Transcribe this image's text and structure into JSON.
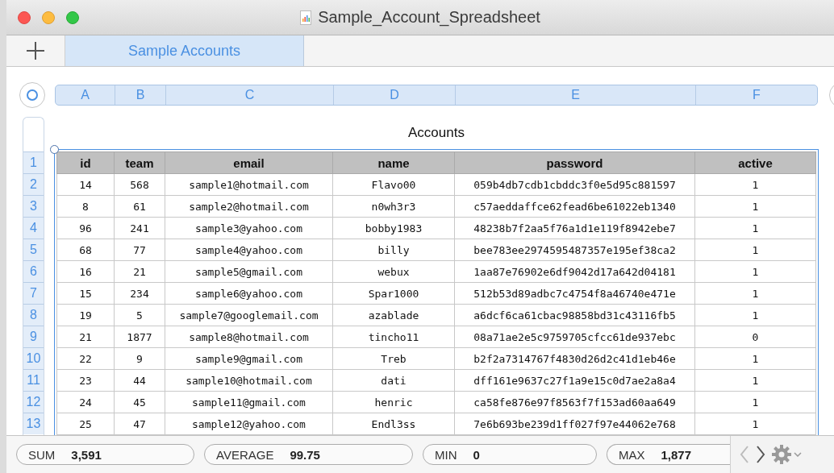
{
  "window": {
    "title": "Sample_Account_Spreadsheet"
  },
  "sheet_tabs": [
    {
      "label": "Sample Accounts",
      "selected": true
    }
  ],
  "column_letters": [
    "A",
    "B",
    "C",
    "D",
    "E",
    "F"
  ],
  "table": {
    "title": "Accounts",
    "row_numbers": [
      "1",
      "2",
      "3",
      "4",
      "5",
      "6",
      "7",
      "8",
      "9",
      "10",
      "11",
      "12",
      "13"
    ],
    "columns": [
      "id",
      "team",
      "email",
      "name",
      "password",
      "active"
    ],
    "rows": [
      [
        "14",
        "568",
        "sample1@hotmail.com",
        "Flavo00",
        "059b4db7cdb1cbddc3f0e5d95c881597",
        "1"
      ],
      [
        "8",
        "61",
        "sample2@hotmail.com",
        "n0wh3r3",
        "c57aeddaffce62fead6be61022eb1340",
        "1"
      ],
      [
        "96",
        "241",
        "sample3@yahoo.com",
        "bobby1983",
        "48238b7f2aa5f76a1d1e119f8942ebe7",
        "1"
      ],
      [
        "68",
        "77",
        "sample4@yahoo.com",
        "billy",
        "bee783ee2974595487357e195ef38ca2",
        "1"
      ],
      [
        "16",
        "21",
        "sample5@gmail.com",
        "webux",
        "1aa87e76902e6df9042d17a642d04181",
        "1"
      ],
      [
        "15",
        "234",
        "sample6@yahoo.com",
        "Spar1000",
        "512b53d89adbc7c4754f8a46740e471e",
        "1"
      ],
      [
        "19",
        "5",
        "sample7@googlemail.com",
        "azablade",
        "a6dcf6ca61cbac98858bd31c43116fb5",
        "1"
      ],
      [
        "21",
        "1877",
        "sample8@hotmail.com",
        "tincho11",
        "08a71ae2e5c9759705cfcc61de937ebc",
        "0"
      ],
      [
        "22",
        "9",
        "sample9@gmail.com",
        "Treb",
        "b2f2a7314767f4830d26d2c41d1eb46e",
        "1"
      ],
      [
        "23",
        "44",
        "sample10@hotmail.com",
        "dati",
        "dff161e9637c27f1a9e15c0d7ae2a8a4",
        "1"
      ],
      [
        "24",
        "45",
        "sample11@gmail.com",
        "henric",
        "ca58fe876e97f8563f7f153ad60aa649",
        "1"
      ],
      [
        "25",
        "47",
        "sample12@yahoo.com",
        "Endl3ss",
        "7e6b693be239d1ff027f97e44062e768",
        "1"
      ]
    ]
  },
  "status_bar": {
    "stats": [
      {
        "label": "SUM",
        "value": "3,591"
      },
      {
        "label": "AVERAGE",
        "value": "99.75"
      },
      {
        "label": "MIN",
        "value": "0"
      },
      {
        "label": "MAX",
        "value": "1,877"
      }
    ]
  }
}
